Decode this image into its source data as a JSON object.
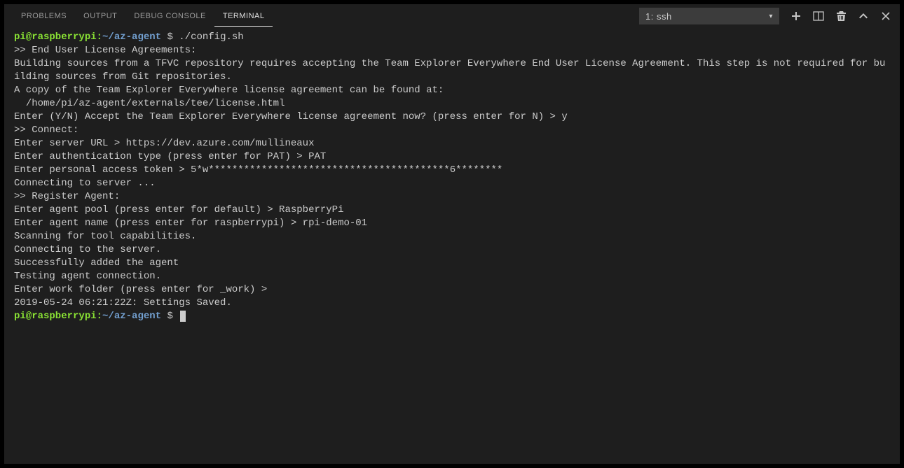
{
  "tabs": {
    "problems": "PROBLEMS",
    "output": "OUTPUT",
    "debug_console": "DEBUG CONSOLE",
    "terminal": "TERMINAL"
  },
  "terminal_selector": "1: ssh",
  "prompt": {
    "user_host": "pi@raspberrypi",
    "colon": ":",
    "path": "~/az-agent",
    "dollar": " $ "
  },
  "command": "./config.sh",
  "lines": {
    "blank": "",
    "eula_header": ">> End User License Agreements:",
    "eula_body1": "Building sources from a TFVC repository requires accepting the Team Explorer Everywhere End User License Agreement. This step is not required for building sources from Git repositories.",
    "eula_body2": "A copy of the Team Explorer Everywhere license agreement can be found at:",
    "eula_path": "  /home/pi/az-agent/externals/tee/license.html",
    "eula_prompt": "Enter (Y/N) Accept the Team Explorer Everywhere license agreement now? (press enter for N) > y",
    "connect_header": ">> Connect:",
    "server_url": "Enter server URL > https://dev.azure.com/mullineaux",
    "auth_type": "Enter authentication type (press enter for PAT) > PAT",
    "pat": "Enter personal access token > 5*w*****************************************6********",
    "connecting": "Connecting to server ...",
    "register_header": ">> Register Agent:",
    "agent_pool": "Enter agent pool (press enter for default) > RaspberryPi",
    "agent_name": "Enter agent name (press enter for raspberrypi) > rpi-demo-01",
    "scanning": "Scanning for tool capabilities.",
    "connecting2": "Connecting to the server.",
    "added": "Successfully added the agent",
    "testing": "Testing agent connection.",
    "work_folder": "Enter work folder (press enter for _work) >",
    "saved": "2019-05-24 06:21:22Z: Settings Saved."
  }
}
